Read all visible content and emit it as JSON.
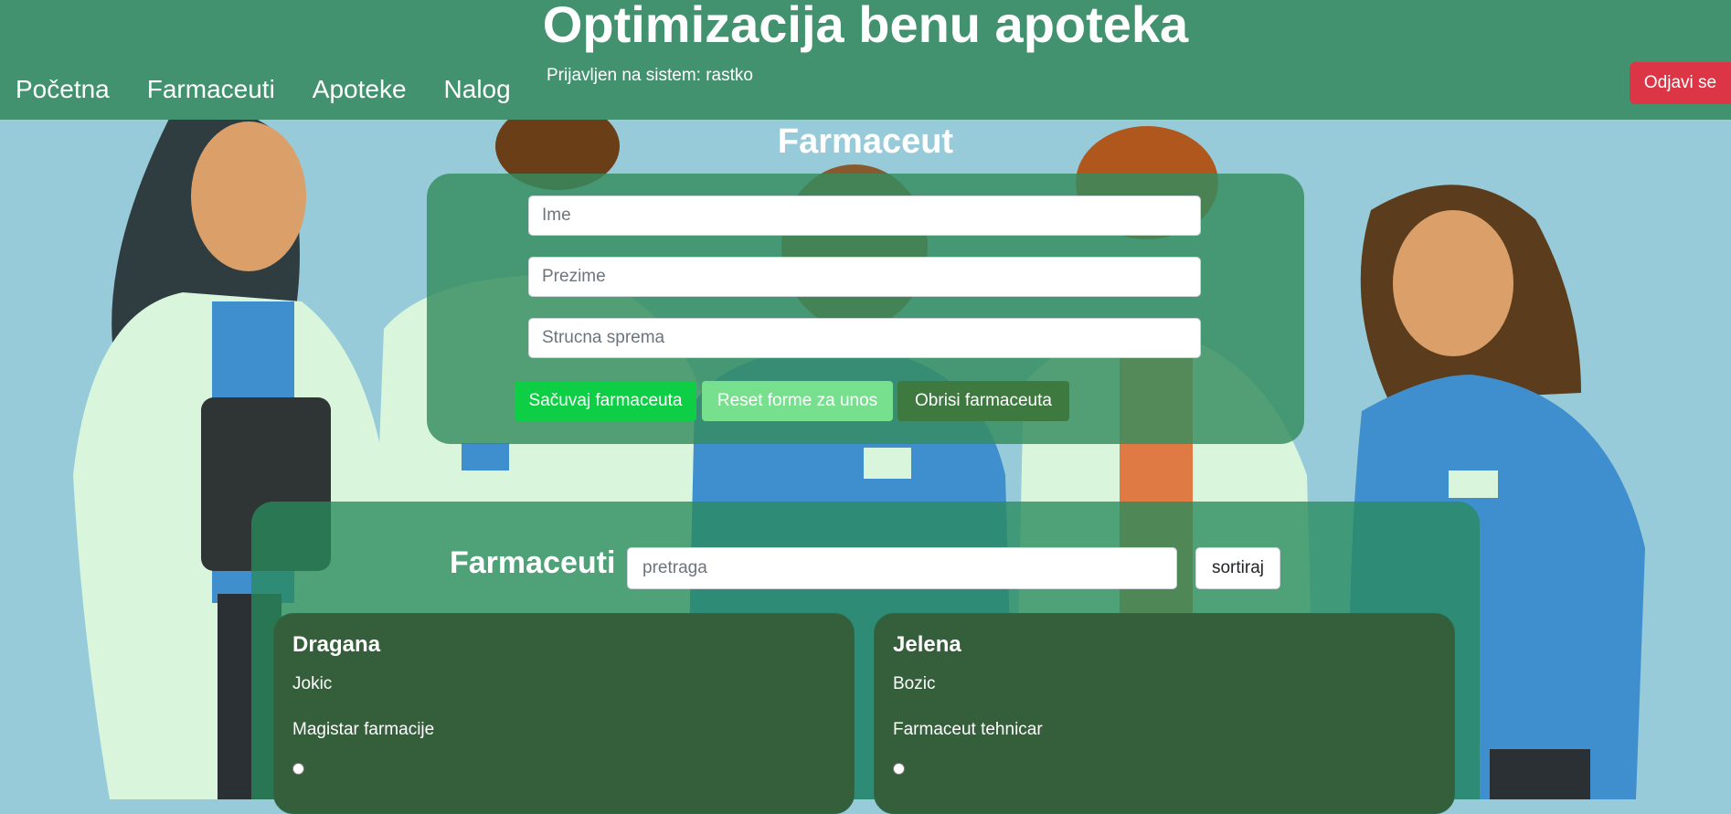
{
  "header": {
    "title": "Optimizacija benu apoteka",
    "nav": [
      "Početna",
      "Farmaceuti",
      "Apoteke",
      "Nalog"
    ],
    "logged_in_text": "Prijavljen na sistem: rastko",
    "logout_label": "Odjavi se"
  },
  "form": {
    "title": "Farmaceut",
    "first_name_placeholder": "Ime",
    "last_name_placeholder": "Prezime",
    "qualification_placeholder": "Strucna sprema",
    "save_label": "Sačuvaj farmaceuta",
    "reset_label": "Reset forme za unos",
    "delete_label": "Obrisi farmaceuta"
  },
  "list": {
    "title": "Farmaceuti",
    "search_placeholder": "pretraga",
    "sort_label": "sortiraj",
    "cards": [
      {
        "first_name": "Dragana",
        "last_name": "Jokic",
        "qualification": "Magistar farmacije"
      },
      {
        "first_name": "Jelena",
        "last_name": "Bozic",
        "qualification": "Farmaceut tehnicar"
      }
    ]
  },
  "colors": {
    "header_bg": "#43926f",
    "page_bg": "#98cbd9",
    "save_button": "#0ece45",
    "reset_button": "#77e08e",
    "delete_button": "#3e7a3f",
    "logout_button": "#dc3545",
    "card_bg": "#355e3b"
  },
  "icons": {
    "background": "pharmacists-illustration"
  }
}
